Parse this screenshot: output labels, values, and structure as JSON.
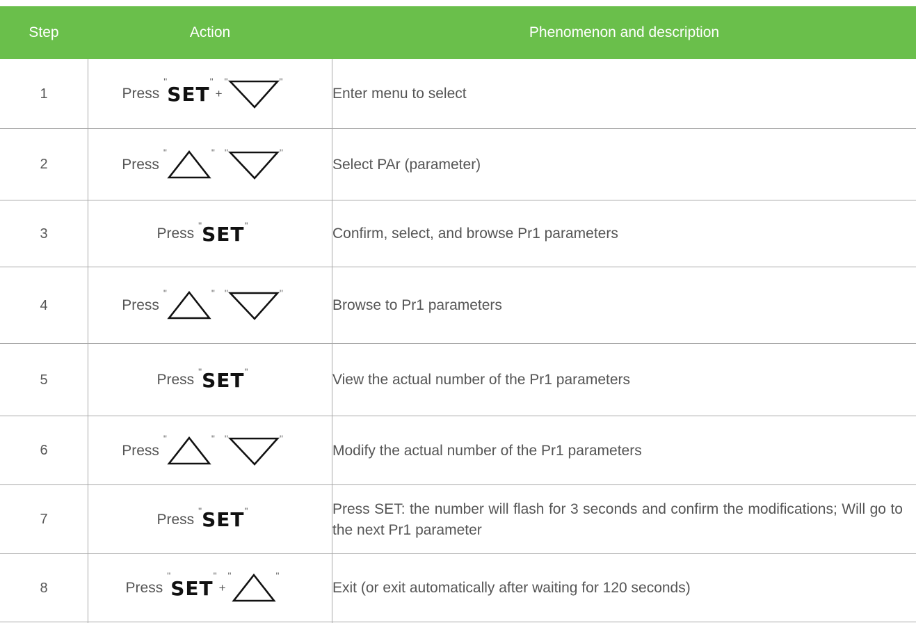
{
  "header": {
    "step": "Step",
    "action": "Action",
    "description": "Phenomenon and description"
  },
  "colors": {
    "header_bg": "#6abf4b",
    "header_text": "#ffffff",
    "grid": "#a8a8a8",
    "text": "#555555"
  },
  "common": {
    "press": "Press",
    "set": "SET",
    "quote": "\"",
    "plus": "+"
  },
  "rows": [
    {
      "step": "1",
      "keys": [
        "SET",
        "+",
        "down-arrow"
      ],
      "desc": "Enter menu to select"
    },
    {
      "step": "2",
      "keys": [
        "up-arrow",
        "down-arrow"
      ],
      "desc": "Select  PAr (parameter)"
    },
    {
      "step": "3",
      "keys": [
        "SET"
      ],
      "desc": "Confirm, select, and browse Pr1 parameters"
    },
    {
      "step": "4",
      "keys": [
        "up-arrow",
        "down-arrow"
      ],
      "desc": "Browse to Pr1 parameters"
    },
    {
      "step": "5",
      "keys": [
        "SET"
      ],
      "desc": "View the actual number of the Pr1 parameters"
    },
    {
      "step": "6",
      "keys": [
        "up-arrow",
        "down-arrow"
      ],
      "desc": "Modify the actual number of the Pr1 parameters"
    },
    {
      "step": "7",
      "keys": [
        "SET"
      ],
      "desc": "Press SET: the number will flash for 3 seconds and confirm the modifications; Will go to the next Pr1 parameter"
    },
    {
      "step": "8",
      "keys": [
        "SET",
        "+",
        "up-arrow"
      ],
      "desc": "Exit (or exit automatically after waiting for 120 seconds)"
    }
  ]
}
